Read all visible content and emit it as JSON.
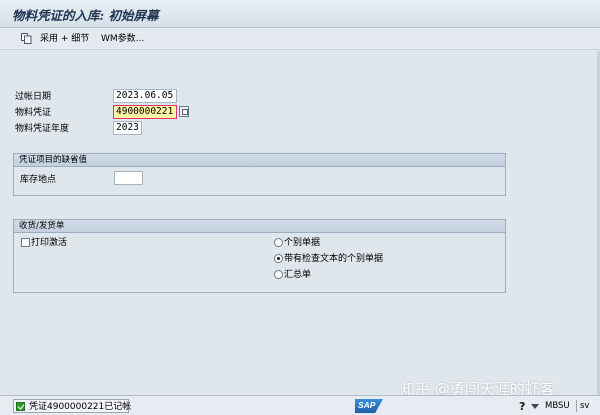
{
  "window": {
    "title": "物料凭证的入库: 初始屏幕"
  },
  "toolbar": {
    "adopt_details_label": "采用 + 细节",
    "wm_params_label": "WM参数..."
  },
  "header_fields": {
    "posting_date": {
      "label": "过帐日期",
      "value": "2023.06.05"
    },
    "material_doc": {
      "label": "物料凭证",
      "value": "4900000221"
    },
    "material_doc_year": {
      "label": "物料凭证年度",
      "value": "2023"
    }
  },
  "defaults_group": {
    "title": "凭证项目的缺省值",
    "storage_location": {
      "label": "库存地点",
      "value": ""
    }
  },
  "slip_group": {
    "title": "收货/发货单",
    "print_active_label": "打印激活",
    "print_active_checked": false,
    "options": [
      {
        "label": "个别单据",
        "selected": false
      },
      {
        "label": "带有检查文本的个别单据",
        "selected": true
      },
      {
        "label": "汇总单",
        "selected": false
      }
    ]
  },
  "status": {
    "message": "凭证4900000221已记帐",
    "type": "success",
    "sap_logo_text": "SAP",
    "transaction": "MBSU",
    "server": "sv"
  },
  "watermark": {
    "text": "知乎 @勇闯天涯的虾客"
  }
}
